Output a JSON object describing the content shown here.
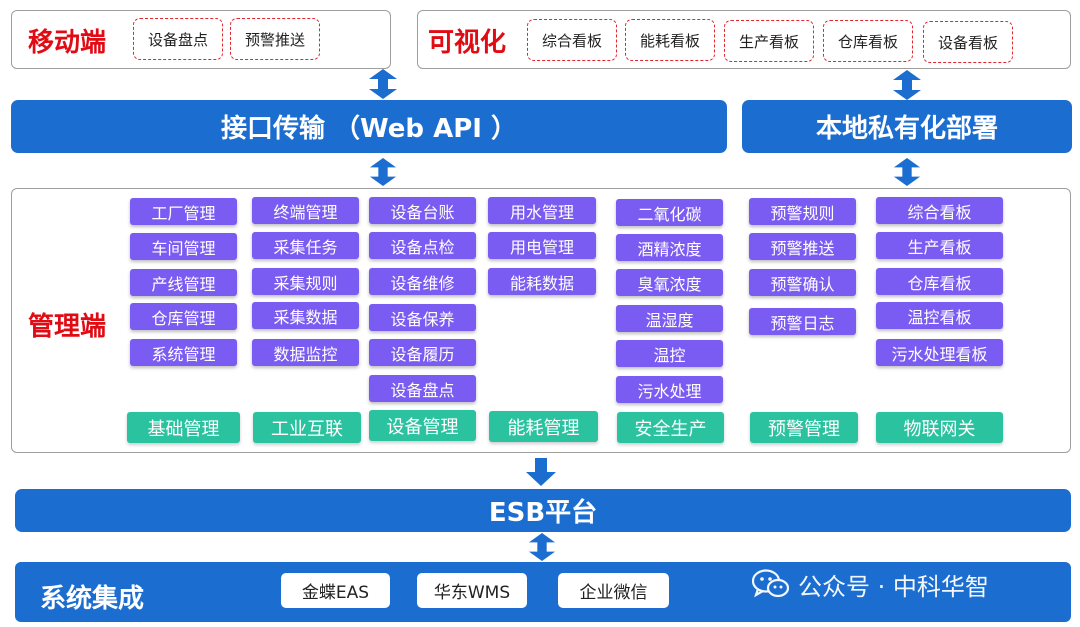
{
  "mobile": {
    "title": "移动端",
    "items": [
      "设备盘点",
      "预警推送"
    ]
  },
  "visual": {
    "title": "可视化",
    "items": [
      "综合看板",
      "能耗看板",
      "生产看板",
      "仓库看板",
      "设备看板"
    ]
  },
  "interface_bar": "接口传输 （Web API ）",
  "local_bar": "本地私有化部署",
  "management": {
    "title": "管理端",
    "columns": [
      {
        "items": [
          "工厂管理",
          "车间管理",
          "产线管理",
          "仓库管理",
          "系统管理"
        ],
        "footer": "基础管理"
      },
      {
        "items": [
          "终端管理",
          "采集任务",
          "采集规则",
          "采集数据",
          "数据监控"
        ],
        "footer": "工业互联"
      },
      {
        "items": [
          "设备台账",
          "设备点检",
          "设备维修",
          "设备保养",
          "设备履历",
          "设备盘点"
        ],
        "footer": "设备管理"
      },
      {
        "items": [
          "用水管理",
          "用电管理",
          "能耗数据"
        ],
        "footer": "能耗管理"
      },
      {
        "items": [
          "二氧化碳",
          "酒精浓度",
          "臭氧浓度",
          "温湿度",
          "温控",
          "污水处理"
        ],
        "footer": "安全生产"
      },
      {
        "items": [
          "预警规则",
          "预警推送",
          "预警确认",
          "预警日志"
        ],
        "footer": "预警管理"
      },
      {
        "items": [
          "综合看板",
          "生产看板",
          "仓库看板",
          "温控看板",
          "污水处理看板"
        ],
        "footer": "物联网关"
      }
    ]
  },
  "esb_bar": "ESB平台",
  "integration": {
    "title": "系统集成",
    "items": [
      "金蝶EAS",
      "华东WMS",
      "企业微信"
    ]
  },
  "watermark": "公众号 · 中科华智",
  "colors": {
    "blue": "#1c6dd0",
    "purple": "#7b5cf2",
    "green": "#2bc2a0",
    "red": "#e10b14"
  }
}
